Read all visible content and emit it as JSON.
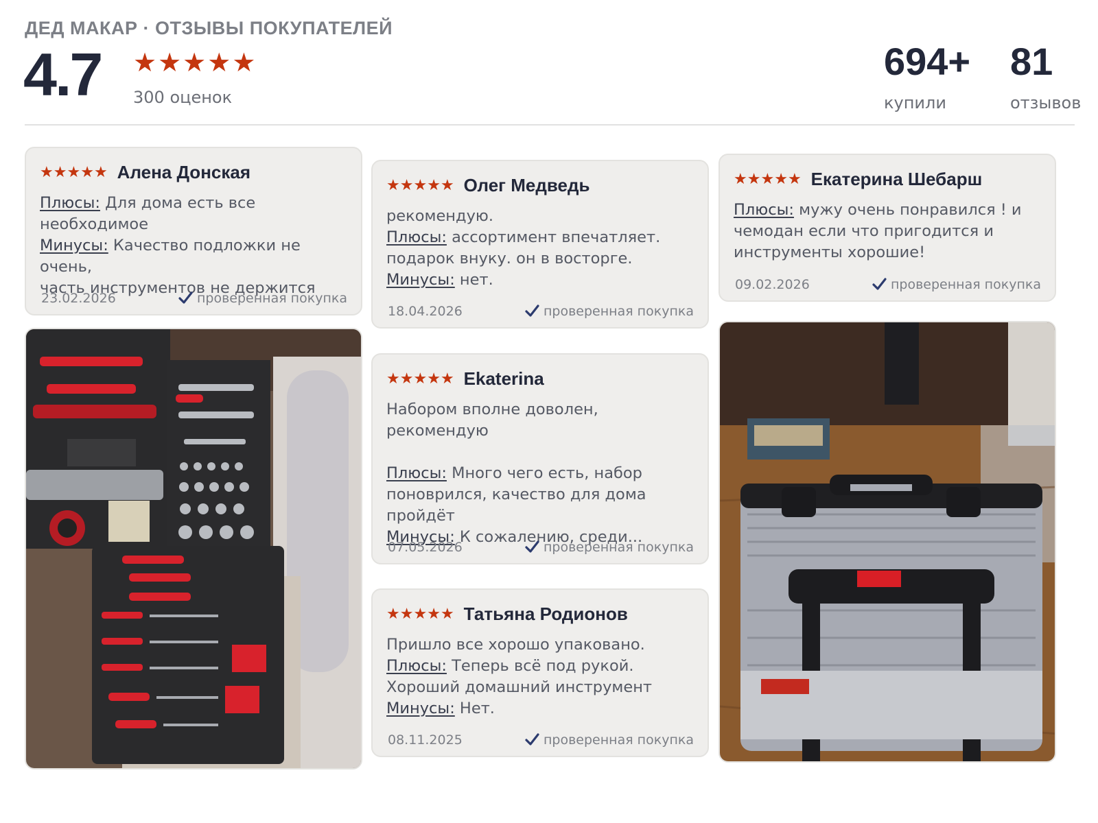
{
  "header": {
    "brand": "ДЕД МАКАР · ОТЗЫВЫ ПОКУПАТЕЛЕЙ",
    "rating": "4.7",
    "stars": 5,
    "ratings_count": "300 оценок",
    "bought_value": "694+",
    "bought_label": "купили",
    "reviews_value": "81",
    "reviews_label": "отзывов"
  },
  "colors": {
    "star": "#c4360f",
    "check": "#2c3b6e",
    "card_bg": "#efeeec"
  },
  "reviews": [
    {
      "author": "Алена Донская",
      "stars": 5,
      "lines": [
        {
          "label": "Плюсы:",
          "text": " Для дома есть все"
        },
        {
          "text": "необходимое"
        },
        {
          "label": "Минусы:",
          "text": " Качество подложки не очень,"
        },
        {
          "text": "часть инструментов не держится"
        }
      ],
      "date": "23.02.2026",
      "verified": "проверенная покупка"
    },
    {
      "author": "Олег Медведь",
      "stars": 5,
      "lines": [
        {
          "text": "рекомендую."
        },
        {
          "label": "Плюсы:",
          "text": " ассортимент впечатляет."
        },
        {
          "text": "подарок внуку. он в восторге."
        },
        {
          "label": "Минусы:",
          "text": " нет."
        }
      ],
      "date": "18.04.2026",
      "verified": "проверенная покупка"
    },
    {
      "author": "Ekaterina",
      "stars": 5,
      "lines": [
        {
          "text": "Набором вполне доволен, рекомендую"
        },
        {
          "text": ""
        },
        {
          "label": "Плюсы:",
          "text": " Много чего есть, набор"
        },
        {
          "text": "поноврился, качество для дома"
        },
        {
          "text": "пройдёт"
        },
        {
          "label": "Минусы:",
          "text": " К сожалению, среди..."
        }
      ],
      "date": "07.05.2026",
      "verified": "проверенная покупка"
    },
    {
      "author": "Татьяна Родионов",
      "stars": 5,
      "lines": [
        {
          "text": "Пришло все хорошо упаковано."
        },
        {
          "label": "Плюсы:",
          "text": " Теперь всё под рукой."
        },
        {
          "text": "Хороший домашний инструмент"
        },
        {
          "label": "Минусы:",
          "text": " Нет."
        }
      ],
      "date": "08.11.2025",
      "verified": "проверенная покупка"
    },
    {
      "author": "Екатерина Шебарш",
      "stars": 5,
      "lines": [
        {
          "label": "Плюсы:",
          "text": " мужу очень понравился ! и"
        },
        {
          "text": "чемодан если что пригодится и"
        },
        {
          "text": "инструменты хорошие!"
        }
      ],
      "date": "09.02.2026",
      "verified": "проверенная покупка"
    }
  ],
  "photos": [
    {
      "caption": "",
      "icon": "open-tool-case-photo"
    },
    {
      "caption": "",
      "icon": "closed-tool-case-photo"
    }
  ]
}
